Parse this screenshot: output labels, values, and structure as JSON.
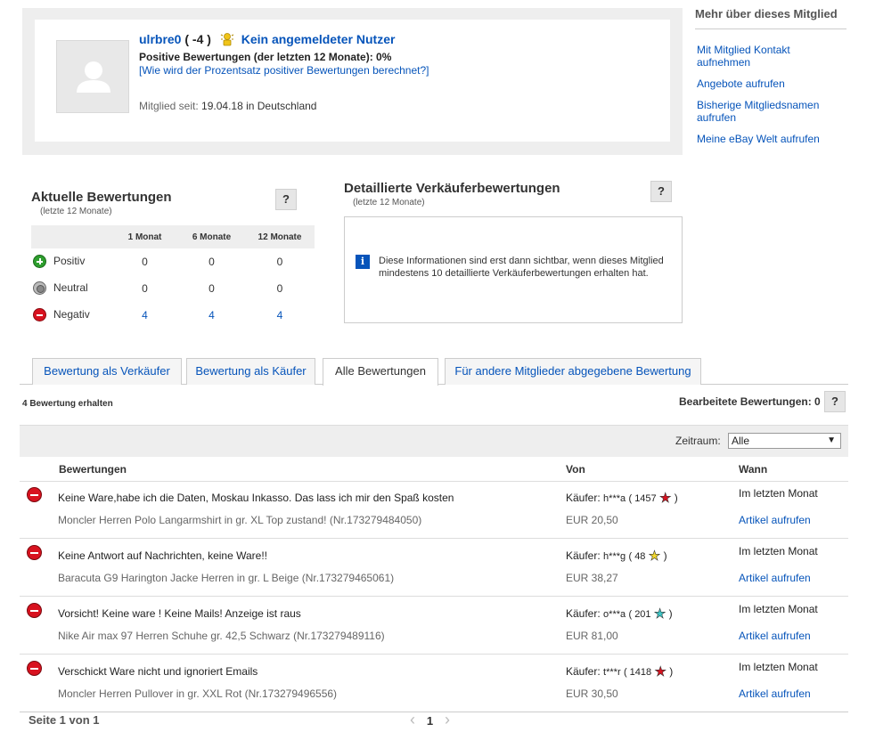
{
  "profile": {
    "username": "ulrbre0",
    "score_open": " ( ",
    "score": "-4",
    "score_close": " )",
    "status": "Kein angemeldeter Nutzer",
    "positive_line": "Positive Bewertungen (der letzten 12 Monate): 0%",
    "percent_link": "[Wie wird der Prozentsatz positiver Bewertungen berechnet?]",
    "member_since_label": "Mitglied seit:",
    "member_since_value": "19.04.18 in Deutschland"
  },
  "sidebar": {
    "title": "Mehr über dieses Mitglied",
    "links": [
      "Mit Mitglied Kontakt aufnehmen",
      "Angebote aufrufen",
      "Bisherige Mitgliedsnamen aufrufen",
      "Meine eBay Welt aufrufen"
    ]
  },
  "current_ratings": {
    "title": "Aktuelle Bewertungen",
    "subtitle": "(letzte 12 Monate)",
    "help": "?",
    "columns": [
      "1 Monat",
      "6 Monate",
      "12 Monate"
    ],
    "rows": [
      {
        "label": "Positiv",
        "values": [
          "0",
          "0",
          "0"
        ]
      },
      {
        "label": "Neutral",
        "values": [
          "0",
          "0",
          "0"
        ]
      },
      {
        "label": "Negativ",
        "values": [
          "4",
          "4",
          "4"
        ]
      }
    ]
  },
  "detailed_ratings": {
    "title": "Detaillierte Verkäuferbewertungen",
    "subtitle": "(letzte 12 Monate)",
    "help": "?",
    "info_icon": "i",
    "info_text": "Diese Informationen sind erst dann sichtbar, wenn dieses Mitglied mindestens 10 detaillierte Verkäuferbewertungen erhalten hat."
  },
  "tabs": [
    "Bewertung als Verkäufer",
    "Bewertung als Käufer",
    "Alle Bewertungen",
    "Für andere Mitglieder abgegebene Bewertung"
  ],
  "active_tab": 2,
  "feedback": {
    "received": "4 Bewertung erhalten",
    "edited": "Bearbeitete Bewertungen: 0",
    "help": "?",
    "period_label": "Zeitraum:",
    "period_value": "Alle",
    "headers": {
      "ratings": "Bewertungen",
      "from": "Von",
      "when": "Wann"
    },
    "entries": [
      {
        "comment": "Keine Ware,habe ich die Daten, Moskau Inkasso. Das lass ich mir den Spaß kosten",
        "item": "Moncler Herren Polo Langarmshirt in gr. XL Top zustand! (Nr.173279484050)",
        "buyer_label": "Käufer:",
        "buyer": "h***a",
        "buyer_score": "( 1457",
        "star_color": "#d8121f",
        "buyer_close": " )",
        "price": "EUR 20,50",
        "when": "Im letzten Monat",
        "view": "Artikel aufrufen"
      },
      {
        "comment": "Keine Antwort auf Nachrichten, keine Ware!!",
        "item": "Baracuta G9 Harington Jacke Herren in gr. L Beige (Nr.173279465061)",
        "buyer_label": "Käufer:",
        "buyer": "h***g",
        "buyer_score": "( 48",
        "star_color": "#f2d82c",
        "buyer_close": " )",
        "price": "EUR 38,27",
        "when": "Im letzten Monat",
        "view": "Artikel aufrufen"
      },
      {
        "comment": "Vorsicht! Keine ware ! Keine Mails! Anzeige ist raus",
        "item": "Nike Air max 97 Herren Schuhe gr. 42,5 Schwarz (Nr.173279489116)",
        "buyer_label": "Käufer:",
        "buyer": "o***a",
        "buyer_score": "( 201",
        "star_color": "#3ec7c7",
        "buyer_close": " )",
        "price": "EUR 81,00",
        "when": "Im letzten Monat",
        "view": "Artikel aufrufen"
      },
      {
        "comment": "Verschickt Ware nicht und ignoriert Emails",
        "item": "Moncler Herren Pullover in gr. XXL Rot (Nr.173279496556)",
        "buyer_label": "Käufer:",
        "buyer": "t***r",
        "buyer_score": "( 1418",
        "star_color": "#d8121f",
        "buyer_close": " )",
        "price": "EUR 30,50",
        "when": "Im letzten Monat",
        "view": "Artikel aufrufen"
      }
    ]
  },
  "pagination": {
    "page_info": "Seite 1 von 1",
    "current": "1"
  }
}
